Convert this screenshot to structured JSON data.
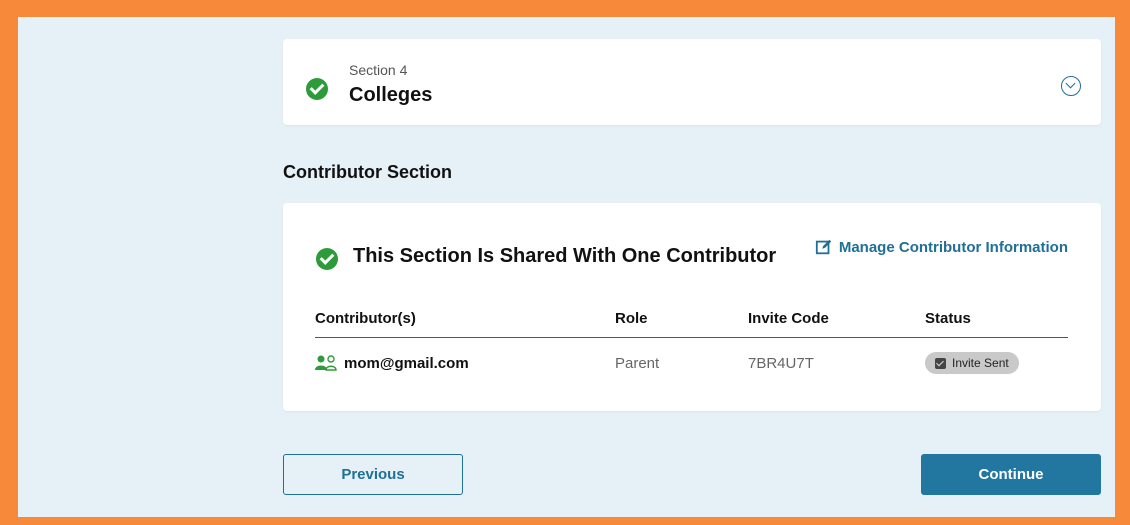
{
  "section": {
    "number_label": "Section 4",
    "title": "Colleges"
  },
  "contributor_section": {
    "heading": "Contributor Section",
    "shared_title": "This Section Is Shared With One Contributor",
    "manage_link": "Manage Contributor Information",
    "columns": [
      "Contributor(s)",
      "Role",
      "Invite Code",
      "Status"
    ],
    "rows": [
      {
        "email": "mom@gmail.com",
        "role": "Parent",
        "invite_code": "7BR4U7T",
        "status": "Invite Sent"
      }
    ]
  },
  "nav": {
    "previous_label": "Previous",
    "continue_label": "Continue"
  },
  "colors": {
    "border_orange": "#f68a3a",
    "background": "#e6f1f7",
    "check_green": "#2e9b3a",
    "accent_blue": "#2277a0"
  },
  "icons": [
    "check-circle-icon",
    "chevron-down-circle-icon",
    "edit-icon",
    "users-icon",
    "checkbox-icon"
  ]
}
